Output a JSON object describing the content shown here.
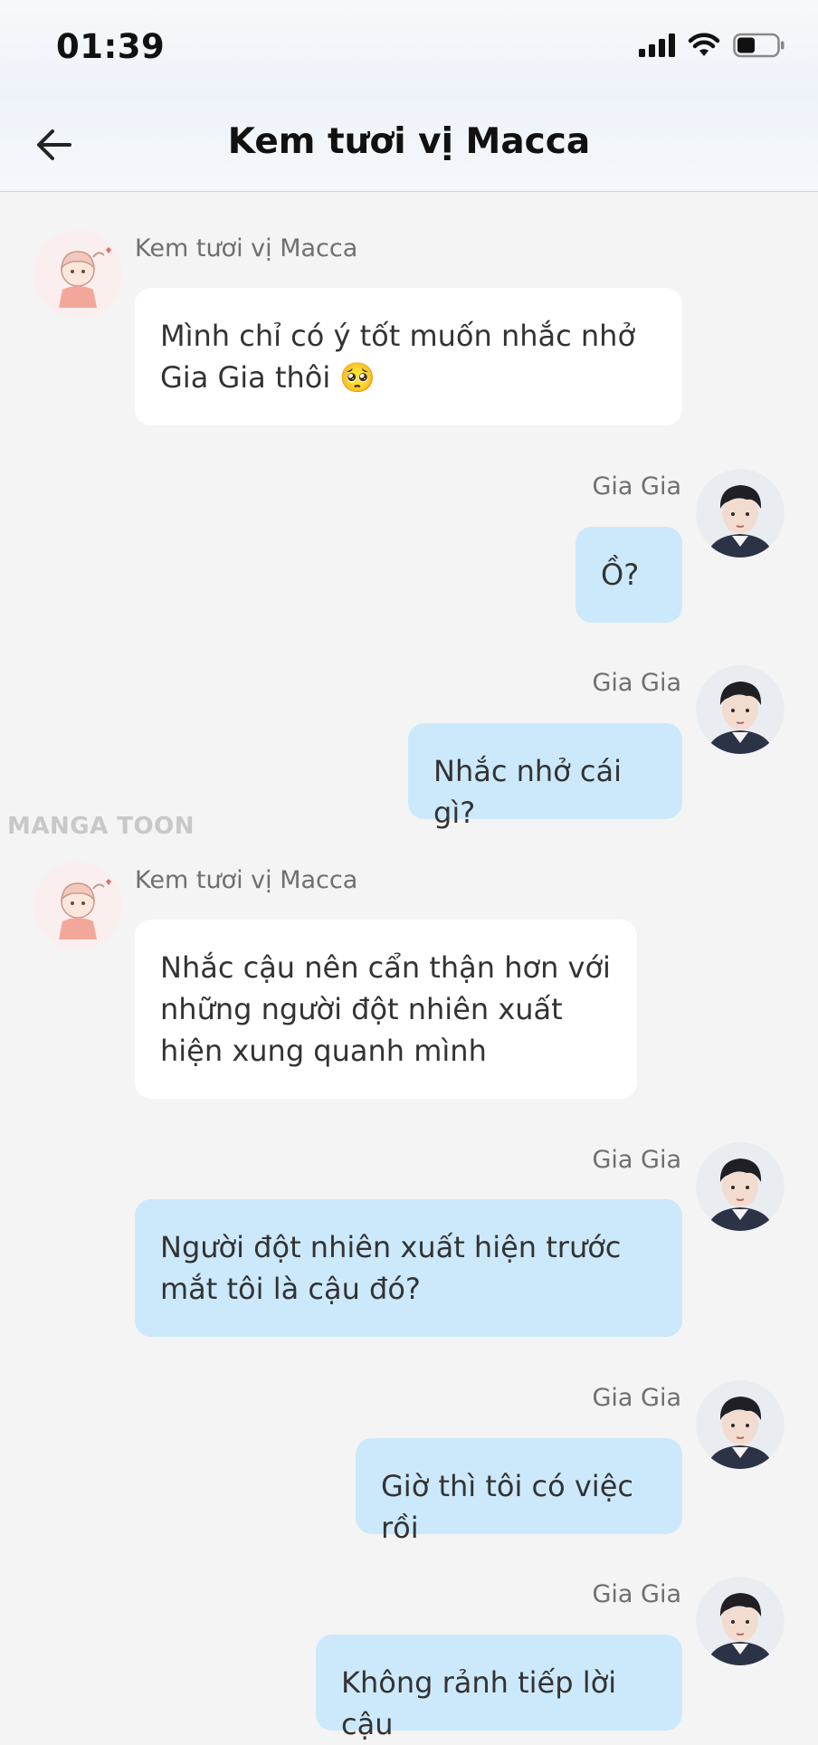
{
  "status_bar": {
    "time": "01:39"
  },
  "header": {
    "title": "Kem tươi vị Macca"
  },
  "watermark": "MANGA TOON",
  "messages": [
    {
      "sender": "Kem tươi vị Macca",
      "text": "Mình chỉ có ý tốt muốn nhắc nhở Gia Gia thôi 🥺",
      "side": "left"
    },
    {
      "sender": "Gia Gia",
      "text": "Ồ?",
      "side": "right"
    },
    {
      "sender": "Gia Gia",
      "text": "Nhắc nhở cái gì?",
      "side": "right"
    },
    {
      "sender": "Kem tươi vị Macca",
      "text": "Nhắc cậu nên cẩn thận hơn với những người đột nhiên xuất hiện xung quanh mình",
      "side": "left"
    },
    {
      "sender": "Gia Gia",
      "text": "Người đột nhiên xuất hiện trước mắt tôi là cậu đó?",
      "side": "right"
    },
    {
      "sender": "Gia Gia",
      "text": "Giờ thì tôi có việc rồi",
      "side": "right"
    },
    {
      "sender": "Gia Gia",
      "text": "Không rảnh tiếp lời cậu",
      "side": "right"
    }
  ],
  "icons": {
    "back": "arrow-left-icon",
    "signal": "cellular-signal-icon",
    "wifi": "wifi-icon",
    "battery": "battery-icon",
    "avatar_left": "girl-avatar",
    "avatar_right": "boy-avatar"
  },
  "colors": {
    "background": "#f4f4f4",
    "left_bubble": "#ffffff",
    "right_bubble": "#cce9fb",
    "sender_text": "#6f6f6f"
  }
}
